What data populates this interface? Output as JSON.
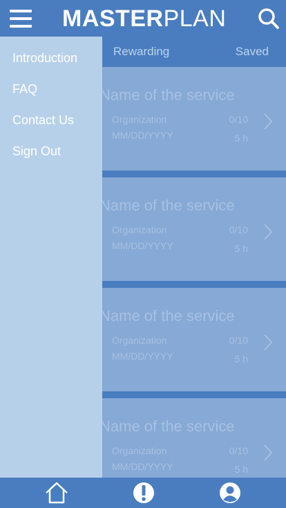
{
  "header": {
    "logo_bold": "MASTER",
    "logo_light": "PLAN",
    "menu_icon": "hamburger-menu-icon",
    "search_icon": "search-icon"
  },
  "tabs": [
    {
      "label": "Rewarding"
    },
    {
      "label": "Saved"
    }
  ],
  "drawer": {
    "items": [
      {
        "label": "Introduction"
      },
      {
        "label": "FAQ"
      },
      {
        "label": "Contact Us"
      },
      {
        "label": "Sign Out"
      }
    ]
  },
  "services": [
    {
      "title": "Name of the service",
      "organization": "Organization",
      "date": "MM/DD/YYYY",
      "score": "0/10",
      "hours": "5 h"
    },
    {
      "title": "Name of the service",
      "organization": "Organization",
      "date": "MM/DD/YYYY",
      "score": "0/10",
      "hours": "5 h"
    },
    {
      "title": "Name of the service",
      "organization": "Organization",
      "date": "MM/DD/YYYY",
      "score": "0/10",
      "hours": "5 h"
    },
    {
      "title": "Name of the service",
      "organization": "Organization",
      "date": "MM/DD/YYYY",
      "score": "0/10",
      "hours": "5 h"
    }
  ],
  "bottom_nav": {
    "items": [
      {
        "icon": "home-icon"
      },
      {
        "icon": "alert-icon"
      },
      {
        "icon": "profile-icon"
      }
    ]
  },
  "colors": {
    "primary": "#4a7dbf",
    "card": "#86a9d6",
    "drawer": "#b7d0ea",
    "muted_text": "#a8c1e2"
  }
}
